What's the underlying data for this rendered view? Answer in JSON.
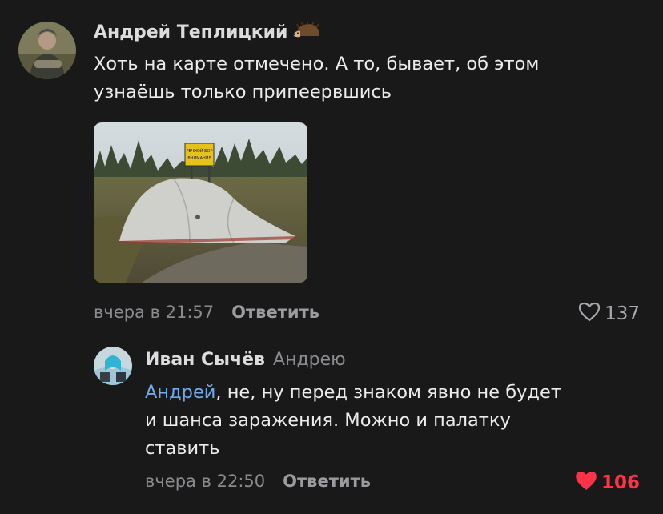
{
  "comments": [
    {
      "author": "Андрей Теплицкий",
      "author_badge_icon": "hedgehog-icon",
      "text_line1": "Хоть на карте отмечено. А то, бывает, об этом",
      "text_line2": "узнаёшь только припеервшись",
      "attachment": {
        "type": "photo",
        "sign_line1": "РЕЧНОЙ БОР",
        "sign_line2": "ВНИМАНИЕ"
      },
      "time": "вчера в 21:57",
      "reply_label": "Ответить",
      "likes": "137",
      "liked": false
    },
    {
      "author": "Иван Сычёв",
      "reply_to": "Андрею",
      "mention": "Андрей",
      "text_line1_rest": ", не, ну перед знаком явно не будет",
      "text_line2": "и шанса заражения. Можно и палатку",
      "text_line3": "ставить",
      "time": "вчера в 22:50",
      "reply_label": "Ответить",
      "likes": "106",
      "liked": true
    }
  ],
  "colors": {
    "background": "#19191a",
    "mention": "#71aaeb",
    "liked": "#ff3347",
    "muted": "#8b8b8f"
  }
}
